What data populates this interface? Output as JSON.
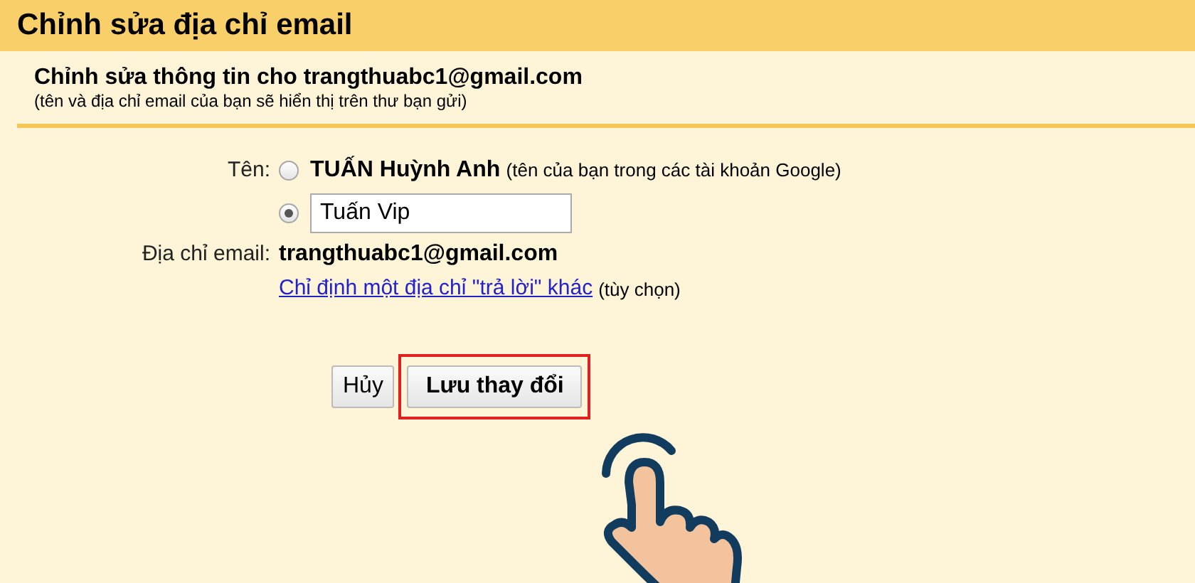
{
  "header": {
    "title": "Chỉnh sửa địa chỉ email"
  },
  "intro": {
    "heading": "Chỉnh sửa thông tin cho trangthuabc1@gmail.com",
    "note": "(tên và địa chỉ email của bạn sẽ hiển thị trên thư bạn gửi)"
  },
  "name_field": {
    "label": "Tên:",
    "options": [
      {
        "kind": "fixed",
        "name": "TUẤN Huỳnh Anh",
        "hint": "(tên của bạn trong các tài khoản Google)",
        "selected": false
      },
      {
        "kind": "input",
        "value": "Tuấn Vip",
        "selected": true
      }
    ]
  },
  "email_field": {
    "label": "Địa chỉ email:",
    "value": "trangthuabc1@gmail.com",
    "link": "Chỉ định một địa chỉ \"trả lời\" khác",
    "link_note": "(tùy chọn)"
  },
  "buttons": [
    {
      "label": "Hủy",
      "highlighted": false
    },
    {
      "label": "Lưu thay đổi",
      "highlighted": true
    }
  ]
}
